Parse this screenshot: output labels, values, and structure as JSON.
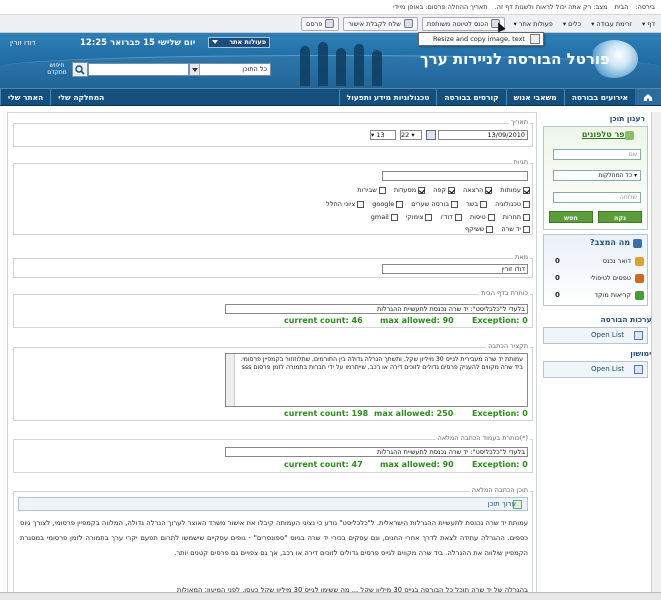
{
  "topbar": {
    "bread_label": "בירסה:",
    "home_link": "הבית",
    "status_text": "מצב: רק אתה יכול לראות ולשנות דף זה.",
    "date_text": "תאריך ההחלה פרסום: באופן מיידי"
  },
  "toolbar": {
    "items": [
      "דף",
      "זרימת עבודה",
      "כלים",
      "פעולות אתר"
    ],
    "hide_btn": "הכנס לטיוטה משותפת",
    "approve_btn": "שלח לקבלת אישור",
    "publish_btn": "פרסם"
  },
  "tooltip": {
    "text": "Resize and copy image, text"
  },
  "header": {
    "site_title": "פורטל הבורסה לניירות ערך",
    "date": "יום שלישי 15 פברואר 12:25",
    "user": "דודו זורין",
    "actions_label": "פעולות אתר",
    "scope_value": "כל התוכן",
    "adv_search": "חיפוש מתקדם"
  },
  "nav": {
    "items": [
      "אירועים בבורסה",
      "משאבי אנוש",
      "קורסים בבורסה",
      "טכנולוגיות מידע ותפעול"
    ],
    "items_left": [
      "המחלקה שלי",
      "האתר שלי"
    ]
  },
  "form": {
    "date_label": "תאריך",
    "date_value": "13/09/2010",
    "day_value": "22",
    "hour_value": "13",
    "tags_label": "תגיות",
    "tags_row1": [
      {
        "label": "עמותות",
        "checked": true
      },
      {
        "label": "הרצאה",
        "checked": true
      },
      {
        "label": "קפה",
        "checked": true
      },
      {
        "label": "מסעדות",
        "checked": true
      },
      {
        "label": "שבירות",
        "checked": false
      }
    ],
    "tags_row2": [
      {
        "label": "טכנולוגיה",
        "checked": false
      },
      {
        "label": "בשר",
        "checked": false
      },
      {
        "label": "בורסה שערים",
        "checked": false
      },
      {
        "label": "google",
        "checked": false
      },
      {
        "label": "ציוני החלל",
        "checked": false
      }
    ],
    "tags_row3": [
      {
        "label": "תחרות",
        "checked": false
      },
      {
        "label": "טיסות",
        "checked": false
      },
      {
        "label": "דוד'ו",
        "checked": false
      },
      {
        "label": "צימוקי",
        "checked": false
      },
      {
        "label": "gmail",
        "checked": false
      }
    ],
    "tags_row4": [
      {
        "label": "יד שרה",
        "checked": false
      },
      {
        "label": "ששיקף",
        "checked": false
      }
    ],
    "author_label": "מאת",
    "author_value": "דודו זורין",
    "homepage_title_label": "כותרת בדף הבית",
    "homepage_title_value": "בלעדי ל\"כלכליסט\": יד שרה נכנסת לתעשיית ההגרלות",
    "homepage_counts": {
      "current": "current count: 46",
      "max": "max allowed: 90",
      "exception": "Exception: 0"
    },
    "summary_label": "תקציר הכתבה",
    "summary_value": "עמותת יד שרה מעבירית לגייס 30 מיליון שקל, ותשתך הגרלה גדולה בין התורמים, שתלוזוזור בקמפיין פרסומי. ביד שרה מקווים להעניק פרסים גדולים לזוכים דירה או רכב, שייתרמו על ידי חברות בתמורה לזמן פרסום    sss",
    "summary_counts": {
      "current": "current count: 198",
      "max": "max allowed: 250",
      "exception": "Exception: 0"
    },
    "full_title_label": "(*)כותרת בעמוד הכתבה המלאה",
    "full_title_value": "בלעדי ל\"כלכליסט\": יד שרה נכנסת לתעשיית ההגרלות",
    "full_title_counts": {
      "current": "current count: 47",
      "max": "max allowed: 90",
      "exception": "Exception: 0"
    },
    "content_label": "תוכן הכתבה המלאה",
    "edit_content_label": "ערוך תוכן",
    "body_text": "עמותת יד שרה נכנסת לתעשיית ההגרלות הישראלית. ל\"כלכליסט\" נודע כי נציגי העמותה קיבלו את אישור משרד האוצר לערוך הגרלה גדולה, המלווה בקמפיין פרסומי, לצורך גיוס כספים. ההגרלה עתידה לצאת לדרך אחרי החגים, וגם עסקים בכירי יד שרה בגיוס \"ספונסרים\" - גופים עסקיים שישמשו לתרום תפעם יקרי ערך בתמורה לזמן פרסומי במסגרת הקמפיין שילווה את ההגרלה. ביד שרה מקווים לגייס פרסים גדולים לזוכים דירה או רכב, אך גם צפויים גם פרסים קטנים יותר.",
    "body_text_2": "בהגרלה של יד שרה תוכל כל הבורסה בגייס 30 מיליון שקל ... מה ששימו לגייס 30 מיליון שקל כעסן, לפני המיעון: המאולות"
  },
  "sidebar": {
    "content_title": "רענון תוכן",
    "phonebook_title": "ספר טלפונים",
    "name_ph": "שם",
    "dept_value": "כל המחלקות",
    "ext_ph": "שלוחה",
    "search_btn": "חפש",
    "clear_btn": "נקה",
    "status_title": "מה המצב?",
    "status_rows": [
      {
        "label": "דואר נכנס",
        "count": "0"
      },
      {
        "label": "טפסים לטיפולי",
        "count": "0"
      },
      {
        "label": "קריאות מוקד",
        "count": "0"
      }
    ],
    "exchange_title": "מערכות הבורסה",
    "exchange_open": "Open List",
    "shimushon_title": "שימושון",
    "shimushon_open": "Open List"
  },
  "colors": {
    "accent": "#1d6aa3",
    "nav": "#154f7e",
    "green": "#2e8b1e",
    "sidebar_btn": "#5d9c3b"
  }
}
